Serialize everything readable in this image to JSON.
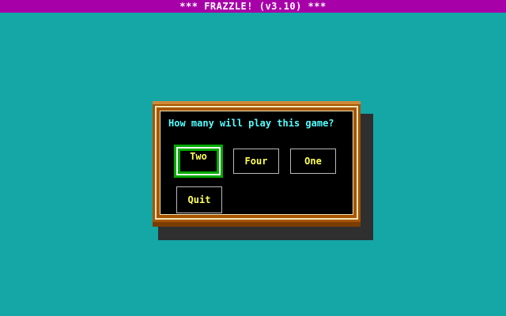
{
  "title": "*** FRAZZLE! (v3.10) ***",
  "dialog": {
    "prompt": "How many will play this game?",
    "buttons": {
      "two": "Two",
      "four": "Four",
      "one": "One",
      "quit": "Quit"
    },
    "selected": "two"
  },
  "colors": {
    "title_bar": "#a800a8",
    "background": "#1ab8b8",
    "frame": "#a85400",
    "prompt_text": "#55ffff",
    "button_text": "#ffff55",
    "selected_highlight": "#00aa00"
  }
}
